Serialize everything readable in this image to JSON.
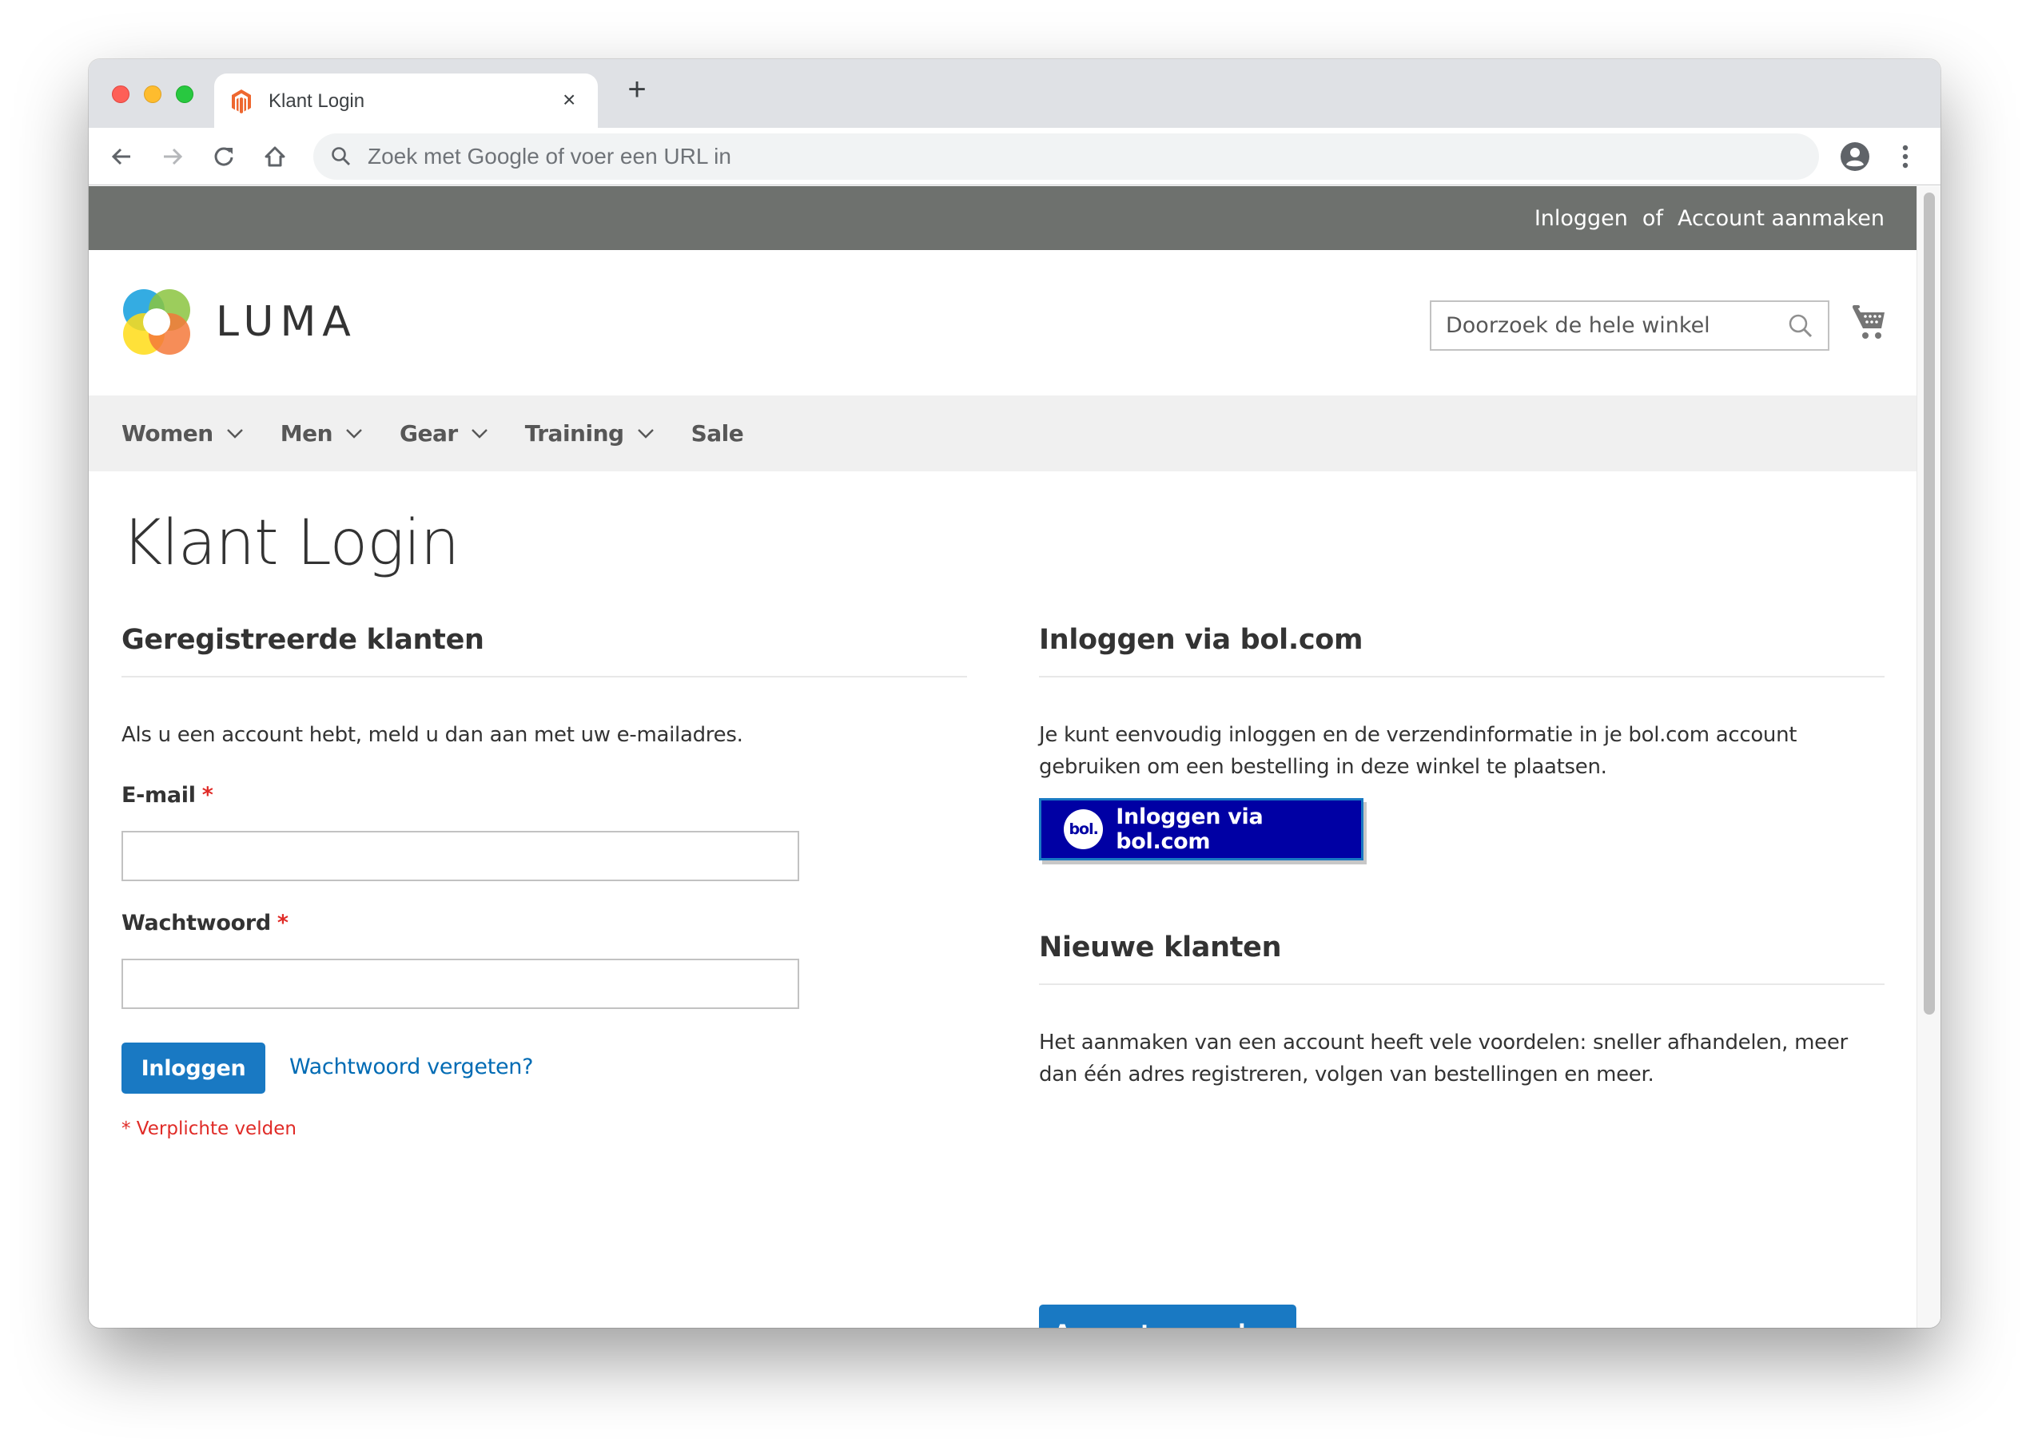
{
  "browser": {
    "tab": {
      "title": "Klant Login",
      "favicon": "magento-icon",
      "close_glyph": "×"
    },
    "new_tab_glyph": "+",
    "address_bar": {
      "value": "",
      "placeholder": "Zoek met Google of voer een URL in"
    },
    "icons": [
      "back-arrow-icon",
      "forward-arrow-icon",
      "reload-icon",
      "home-icon",
      "search-icon",
      "profile-icon",
      "kebab-menu-icon"
    ]
  },
  "store": {
    "top_links": {
      "signin": "Inloggen",
      "separator": "of",
      "create_account": "Account aanmaken"
    },
    "logo_text": "LUMA",
    "search": {
      "value": "",
      "placeholder": "Doorzoek de hele winkel"
    },
    "nav": [
      {
        "label": "Women",
        "has_submenu": true
      },
      {
        "label": "Men",
        "has_submenu": true
      },
      {
        "label": "Gear",
        "has_submenu": true
      },
      {
        "label": "Training",
        "has_submenu": true
      },
      {
        "label": "Sale",
        "has_submenu": false
      }
    ]
  },
  "page": {
    "title": "Klant Login",
    "registered": {
      "heading": "Geregistreerde klanten",
      "intro": "Als u een account hebt, meld u dan aan met uw e-mailadres.",
      "email_label": "E-mail",
      "email_value": "",
      "password_label": "Wachtwoord",
      "password_value": "",
      "required_marker": "*",
      "submit_label": "Inloggen",
      "forgot_link": "Wachtwoord vergeten?",
      "required_note": "* Verplichte velden"
    },
    "bol": {
      "heading": "Inloggen via bol.com",
      "text": "Je kunt eenvoudig inloggen en de verzendinformatie in je bol.com account gebruiken om een bestelling in deze winkel te plaatsen.",
      "button_logo": "bol.",
      "button_label": "Inloggen via bol.com"
    },
    "new_customers": {
      "heading": "Nieuwe klanten",
      "text": "Het aanmaken van een account heeft vele voordelen: sneller afhandelen, meer dan één adres registreren, volgen van bestellingen en meer.",
      "button_label": "Account aanmaken"
    }
  },
  "colors": {
    "primary_button": "#1979c3",
    "link": "#006bb4",
    "required": "#e02b27",
    "bol_button": "#0000a4",
    "top_panel": "#6e716e",
    "nav_bg": "#f0f0f0"
  }
}
